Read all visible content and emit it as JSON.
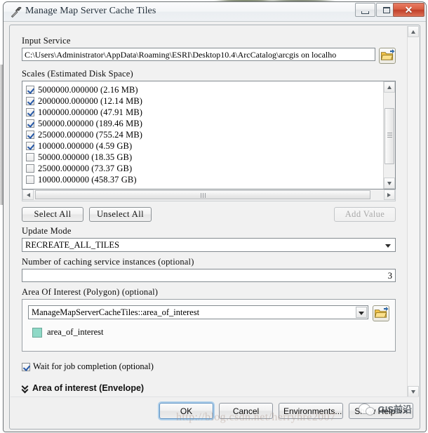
{
  "window": {
    "title": "Manage Map Server Cache Tiles",
    "icon": "hammer-tool-icon",
    "controls": {
      "minimize": "minimize-icon",
      "maximize": "maximize-icon",
      "close": "✕"
    }
  },
  "form": {
    "input_service": {
      "label": "Input Service",
      "value": "C:\\Users\\Administrator\\AppData\\Roaming\\ESRI\\Desktop10.4\\ArcCatalog\\arcgis on localho",
      "browse_icon": "open-folder-icon"
    },
    "scales": {
      "label": "Scales (Estimated Disk Space)",
      "items": [
        {
          "checked": true,
          "text": "5000000.000000  (2.16 MB)"
        },
        {
          "checked": true,
          "text": "2000000.000000  (12.14 MB)"
        },
        {
          "checked": true,
          "text": "1000000.000000  (47.91 MB)"
        },
        {
          "checked": true,
          "text": "500000.000000  (189.46 MB)"
        },
        {
          "checked": true,
          "text": "250000.000000  (755.24 MB)"
        },
        {
          "checked": true,
          "text": "100000.000000  (4.59 GB)"
        },
        {
          "checked": false,
          "text": "50000.000000  (18.35 GB)"
        },
        {
          "checked": false,
          "text": "25000.000000  (73.37 GB)"
        },
        {
          "checked": false,
          "text": "10000.000000  (458.37 GB)"
        }
      ]
    },
    "list_buttons": {
      "select_all": "Select All",
      "unselect_all": "Unselect All",
      "add_value": "Add Value"
    },
    "update_mode": {
      "label": "Update Mode",
      "value": "RECREATE_ALL_TILES"
    },
    "instances": {
      "label": "Number of caching service instances (optional)",
      "value": "3"
    },
    "area_of_interest": {
      "label": "Area Of Interest (Polygon) (optional)",
      "value": "ManageMapServerCacheTiles::area_of_interest",
      "browse_icon": "open-folder-icon",
      "layer_item": "area_of_interest",
      "swatch_color": "#8fd9c7"
    },
    "wait_for_job": {
      "label": "Wait for job completion (optional)",
      "checked": true
    },
    "section_envelope": {
      "label": "Area of interest (Envelope)",
      "expander_icon": "chevron-double-down-icon"
    }
  },
  "footer": {
    "ok": "OK",
    "cancel": "Cancel",
    "environments": "Environments...",
    "show_help": "Show Help >>"
  },
  "watermarks": {
    "url": "http://blog.csdn.net/herryhre2007",
    "badge_text": "GIS前沿"
  }
}
